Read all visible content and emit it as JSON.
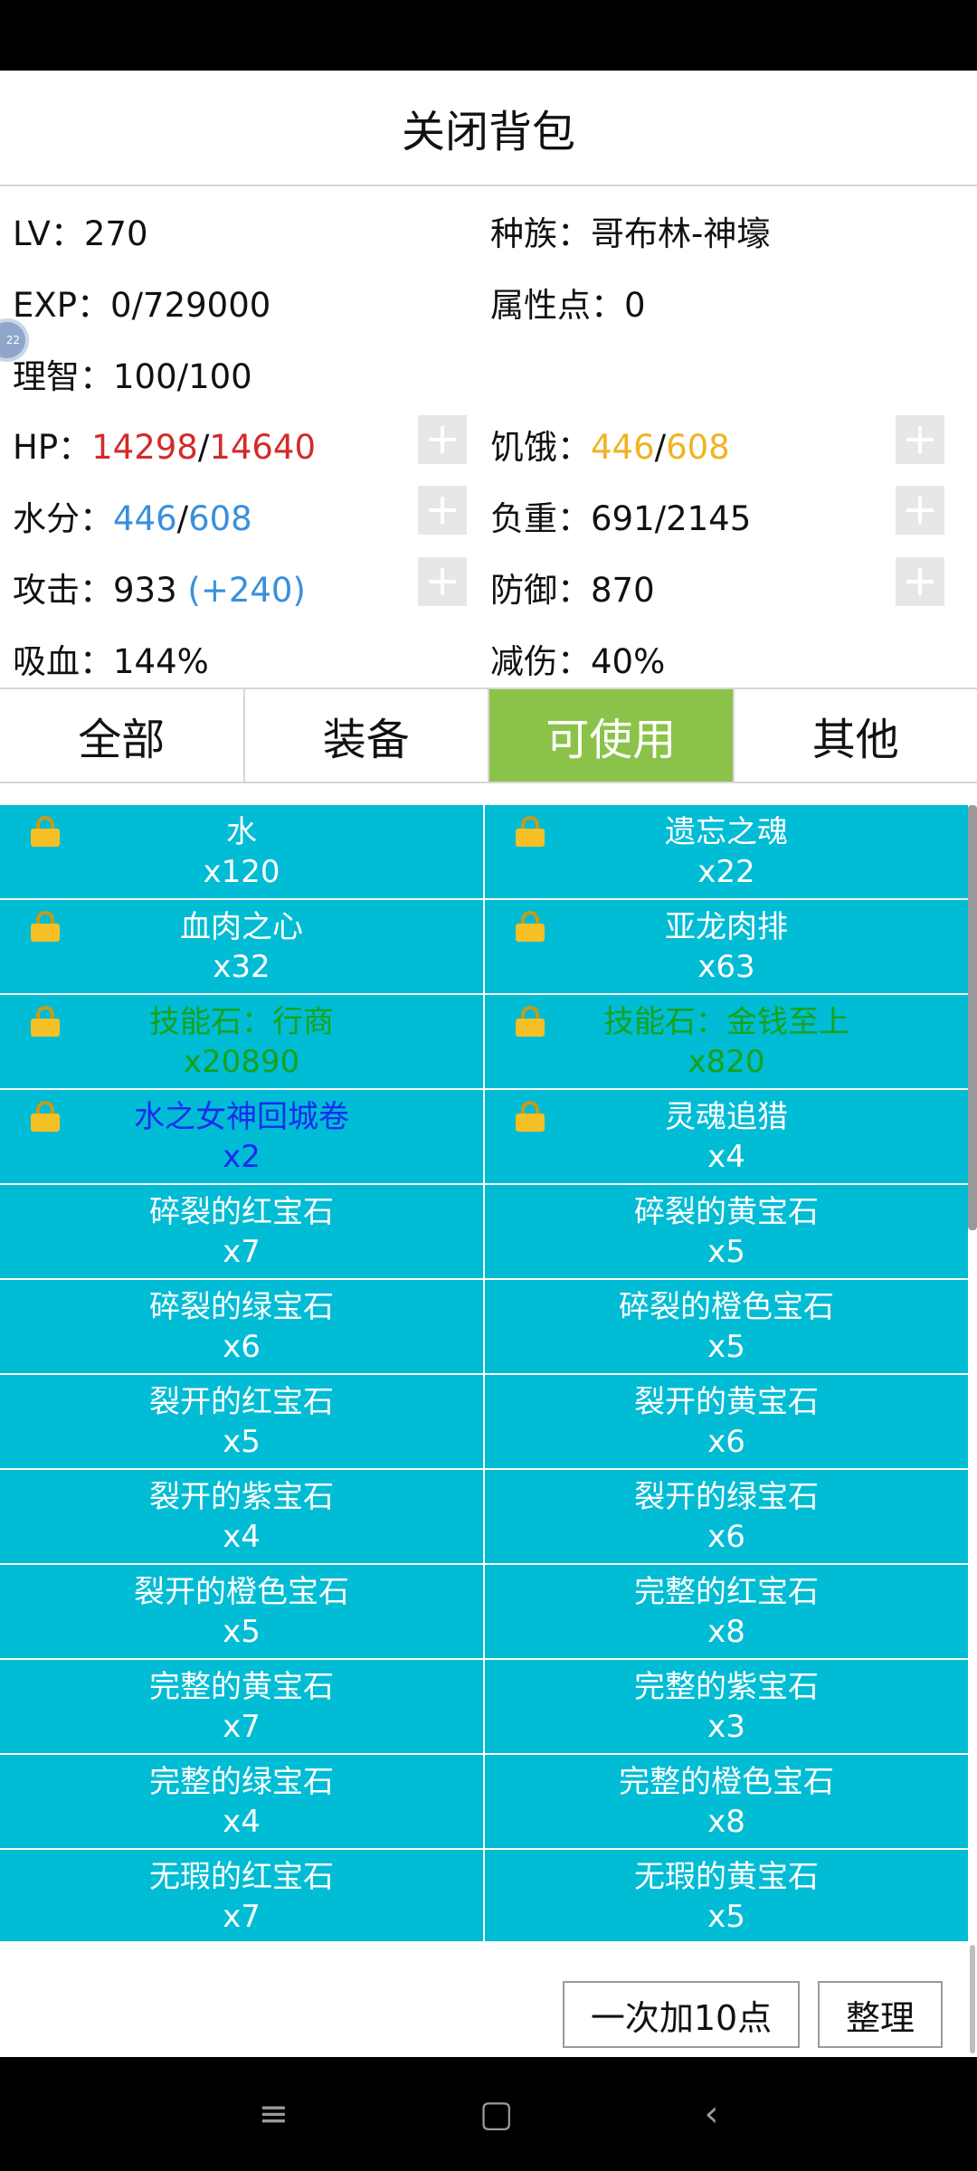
{
  "title": "关闭背包",
  "stats": {
    "lv_label": "LV：",
    "lv_value": "270",
    "race_label": "种族：",
    "race_value": "哥布林-神壕",
    "exp_label": "EXP：",
    "exp_value": "0/729000",
    "attr_label": "属性点：",
    "attr_value": "0",
    "sanity_label": "理智：",
    "sanity_value": "100/100",
    "hp_label": "HP：",
    "hp_current": "14298",
    "hp_sep": "/",
    "hp_max": "14640",
    "hunger_label": "饥饿：",
    "hunger_current": "446",
    "hunger_sep": "/",
    "hunger_max": "608",
    "water_label": "水分：",
    "water_current": "446",
    "water_sep": "/",
    "water_max": "608",
    "load_label": "负重：",
    "load_value": "691/2145",
    "atk_label": "攻击：",
    "atk_value": "933",
    "atk_bonus": "(+240)",
    "def_label": "防御：",
    "def_value": "870",
    "lifesteal_label": "吸血：",
    "lifesteal_value": "144%",
    "dmgred_label": "减伤：",
    "dmgred_value": "40%"
  },
  "side_badge": "22",
  "tabs": [
    {
      "label": "全部"
    },
    {
      "label": "装备"
    },
    {
      "label": "可使用"
    },
    {
      "label": "其他"
    }
  ],
  "active_tab": "可使用",
  "items": [
    {
      "name": "水",
      "count": "x120"
    },
    {
      "name": "遗忘之魂",
      "count": "x22"
    },
    {
      "name": "血肉之心",
      "count": "x32"
    },
    {
      "name": "亚龙肉排",
      "count": "x63"
    },
    {
      "name": "技能石：行商",
      "count": "x20890"
    },
    {
      "name": "技能石：金钱至上",
      "count": "x820"
    },
    {
      "name": "水之女神回城卷",
      "count": "x2"
    },
    {
      "name": "灵魂追猎",
      "count": "x4"
    },
    {
      "name": "碎裂的红宝石",
      "count": "x7"
    },
    {
      "name": "碎裂的黄宝石",
      "count": "x5"
    },
    {
      "name": "碎裂的绿宝石",
      "count": "x6"
    },
    {
      "name": "碎裂的橙色宝石",
      "count": "x5"
    },
    {
      "name": "裂开的红宝石",
      "count": "x5"
    },
    {
      "name": "裂开的黄宝石",
      "count": "x6"
    },
    {
      "name": "裂开的紫宝石",
      "count": "x4"
    },
    {
      "name": "裂开的绿宝石",
      "count": "x6"
    },
    {
      "name": "裂开的橙色宝石",
      "count": "x5"
    },
    {
      "name": "完整的红宝石",
      "count": "x8"
    },
    {
      "name": "完整的黄宝石",
      "count": "x7"
    },
    {
      "name": "完整的紫宝石",
      "count": "x3"
    },
    {
      "name": "完整的绿宝石",
      "count": "x4"
    },
    {
      "name": "完整的橙色宝石",
      "count": "x8"
    },
    {
      "name": "无瑕的红宝石",
      "count": "x7"
    },
    {
      "name": "无瑕的黄宝石",
      "count": "x5"
    }
  ],
  "buttons": {
    "add10": "一次加10点",
    "sort": "整理"
  },
  "navbar": {
    "menu_icon": "≡",
    "home_icon": "▢",
    "back_icon": "‹"
  },
  "colors": {
    "item_bg": "#00bcd4",
    "active_tab": "#8bc34a",
    "hp": "#d42a2a",
    "hunger": "#f0b321",
    "water": "#3a8fdc"
  }
}
